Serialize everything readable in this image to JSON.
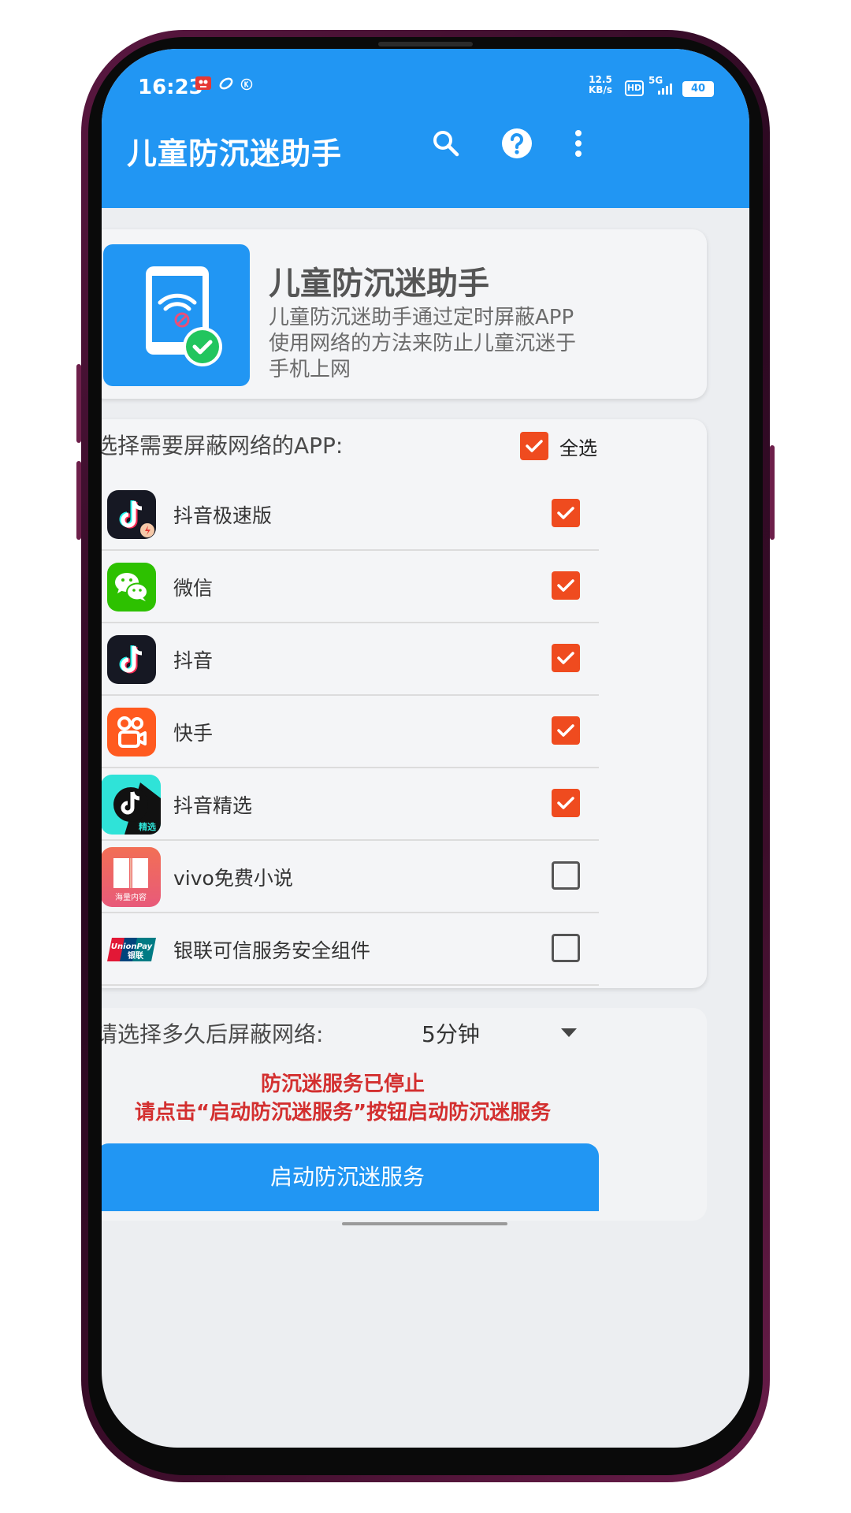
{
  "status_bar": {
    "time": "16:23",
    "net_speed_value": "12.5",
    "net_speed_unit": "KB/s",
    "hd": "HD",
    "network": "5G",
    "battery": "40"
  },
  "appbar": {
    "title": "儿童防沉迷助手",
    "icons": [
      "search-icon",
      "help-icon",
      "more-vert-icon"
    ]
  },
  "intro": {
    "title": "儿童防沉迷助手",
    "description": "儿童防沉迷助手通过定时屏蔽APP使用网络的方法来防止儿童沉迷于手机上网"
  },
  "app_list": {
    "header": "选择需要屏蔽网络的APP:",
    "select_all_label": "全选",
    "select_all_checked": true,
    "apps": [
      {
        "name": "抖音极速版",
        "checked": true
      },
      {
        "name": "微信",
        "checked": true
      },
      {
        "name": "抖音",
        "checked": true
      },
      {
        "name": "快手",
        "checked": true
      },
      {
        "name": "抖音精选",
        "checked": true
      },
      {
        "name": "vivo免费小说",
        "checked": false
      },
      {
        "name": "银联可信服务安全组件",
        "checked": false
      }
    ]
  },
  "timer": {
    "label": "请选择多久后屏蔽网络:",
    "selected": "5分钟"
  },
  "status_message": {
    "line1": "防沉迷服务已停止",
    "line2": "请点击“启动防沉迷服务”按钮启动防沉迷服务"
  },
  "start_button": "启动防沉迷服务",
  "icon_labels": {
    "jingxuan": "精选",
    "novel": "海量内容",
    "unionpay_en": "UnionPay",
    "unionpay_cn": "银联"
  },
  "colors": {
    "primary": "#2196f3",
    "checkbox": "#ef4b1f",
    "warning_text": "#d32f2f"
  }
}
